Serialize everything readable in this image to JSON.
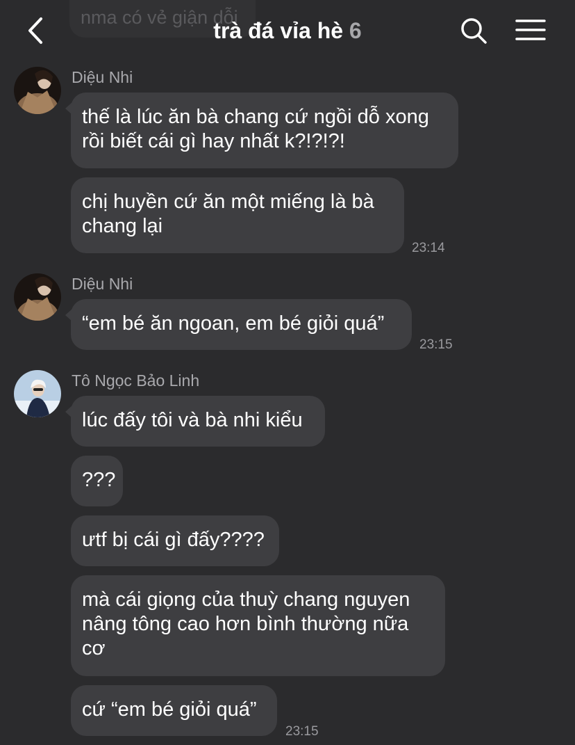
{
  "header": {
    "ghost_text": "nma có vẻ giận dỗi",
    "title": "trà đá vỉa hè",
    "member_count": "6"
  },
  "messages": [
    {
      "sender": "Diệu Nhi",
      "bubbles": [
        "thế là lúc ăn bà chang cứ ngồi dỗ xong rồi biết cái gì hay nhất k?!?!?!",
        "chị huyền cứ ăn một miếng là bà chang lại"
      ],
      "time": "23:14"
    },
    {
      "sender": "Diệu Nhi",
      "bubbles": [
        "“em bé ăn ngoan, em bé giỏi quá”"
      ],
      "time": "23:15"
    },
    {
      "sender": "Tô Ngọc Bảo Linh",
      "bubbles": [
        "lúc đấy tôi và bà nhi kiểu",
        "???",
        "ưtf bị cái gì đấy????",
        "mà cái giọng của thuỳ chang nguyen nâng tông cao hơn bình thường nữa cơ",
        "cứ “em bé giỏi quá”"
      ],
      "time": "23:15"
    }
  ]
}
